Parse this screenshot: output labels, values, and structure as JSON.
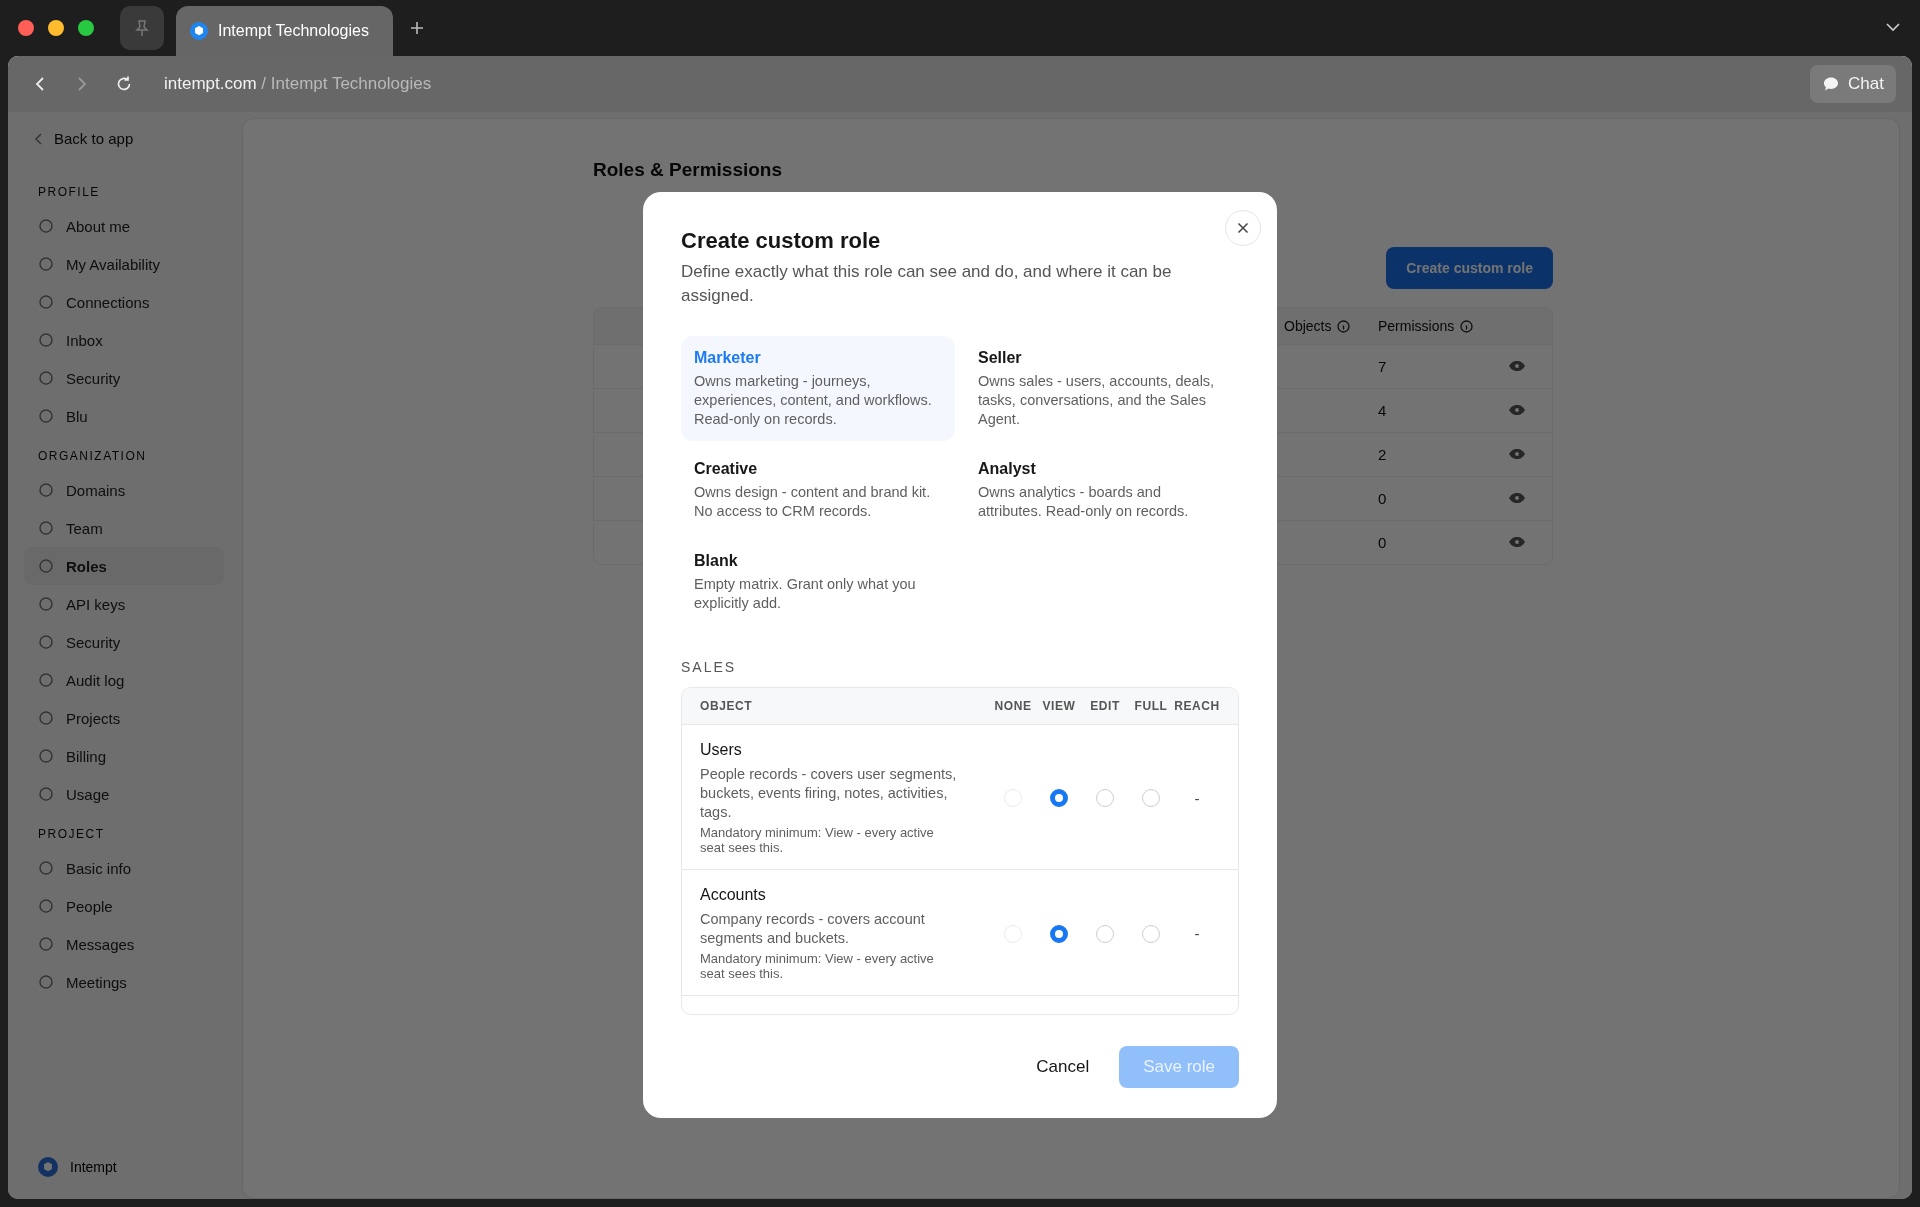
{
  "browser": {
    "tab_title": "Intempt Technologies",
    "url_domain": "intempt.com",
    "url_separator": "/",
    "url_page": "Intempt Technologies",
    "chat_button": "Chat"
  },
  "sidebar": {
    "back_link": "Back to app",
    "sections": [
      {
        "heading": "PROFILE",
        "items": [
          {
            "label": "About me",
            "selected": false
          },
          {
            "label": "My Availability",
            "selected": false
          },
          {
            "label": "Connections",
            "selected": false
          },
          {
            "label": "Inbox",
            "selected": false
          },
          {
            "label": "Security",
            "selected": false
          },
          {
            "label": "Blu",
            "selected": false
          }
        ]
      },
      {
        "heading": "ORGANIZATION",
        "items": [
          {
            "label": "Domains",
            "selected": false
          },
          {
            "label": "Team",
            "selected": false
          },
          {
            "label": "Roles",
            "selected": true
          },
          {
            "label": "API keys",
            "selected": false
          },
          {
            "label": "Security",
            "selected": false
          },
          {
            "label": "Audit log",
            "selected": false
          },
          {
            "label": "Projects",
            "selected": false
          },
          {
            "label": "Billing",
            "selected": false
          },
          {
            "label": "Usage",
            "selected": false
          }
        ]
      },
      {
        "heading": "PROJECT",
        "items": [
          {
            "label": "Basic info",
            "selected": false
          },
          {
            "label": "People",
            "selected": false
          },
          {
            "label": "Messages",
            "selected": false
          },
          {
            "label": "Meetings",
            "selected": false
          }
        ]
      }
    ],
    "footer": {
      "org_name": "Intempt"
    }
  },
  "page": {
    "title": "Roles & Permissions",
    "create_button": "Create custom role",
    "table": {
      "headers": [
        "Objects",
        "Permissions"
      ],
      "rows": [
        {
          "permissions": "7"
        },
        {
          "permissions": "4"
        },
        {
          "permissions": "2"
        },
        {
          "permissions": "0"
        },
        {
          "permissions": "0"
        }
      ]
    }
  },
  "dialog": {
    "title": "Create custom role",
    "description": "Define exactly what this role can see and do, and where it can be assigned.",
    "templates": [
      {
        "name": "Marketer",
        "description": "Owns marketing - journeys, experiences, content, and workflows. Read-only on records.",
        "selected": true
      },
      {
        "name": "Seller",
        "description": "Owns sales - users, accounts, deals, tasks, conversations, and the Sales Agent.",
        "selected": false
      },
      {
        "name": "Creative",
        "description": "Owns design - content and brand kit. No access to CRM records.",
        "selected": false
      },
      {
        "name": "Analyst",
        "description": "Owns analytics - boards and attributes. Read-only on records.",
        "selected": false
      },
      {
        "name": "Blank",
        "description": "Empty matrix. Grant only what you explicitly add.",
        "selected": false
      }
    ],
    "section_heading": "SALES",
    "columns": [
      "OBJECT",
      "NONE",
      "VIEW",
      "EDIT",
      "FULL",
      "REACH"
    ],
    "rows": [
      {
        "name": "Users",
        "description": "People records - covers user segments, buckets, events firing, notes, activities, tags.",
        "note": "Mandatory minimum: View - every active seat sees this.",
        "options": [
          {
            "selected": false,
            "disabled": true
          },
          {
            "selected": true,
            "disabled": false
          },
          {
            "selected": false,
            "disabled": false
          },
          {
            "selected": false,
            "disabled": false
          }
        ],
        "reach": "-"
      },
      {
        "name": "Accounts",
        "description": "Company records - covers account segments and buckets.",
        "note": "Mandatory minimum: View - every active seat sees this.",
        "options": [
          {
            "selected": false,
            "disabled": true
          },
          {
            "selected": true,
            "disabled": false
          },
          {
            "selected": false,
            "disabled": false
          },
          {
            "selected": false,
            "disabled": false
          }
        ],
        "reach": "-"
      }
    ],
    "cancel_button": "Cancel",
    "save_button": {
      "label": "Save role",
      "disabled": true
    }
  }
}
